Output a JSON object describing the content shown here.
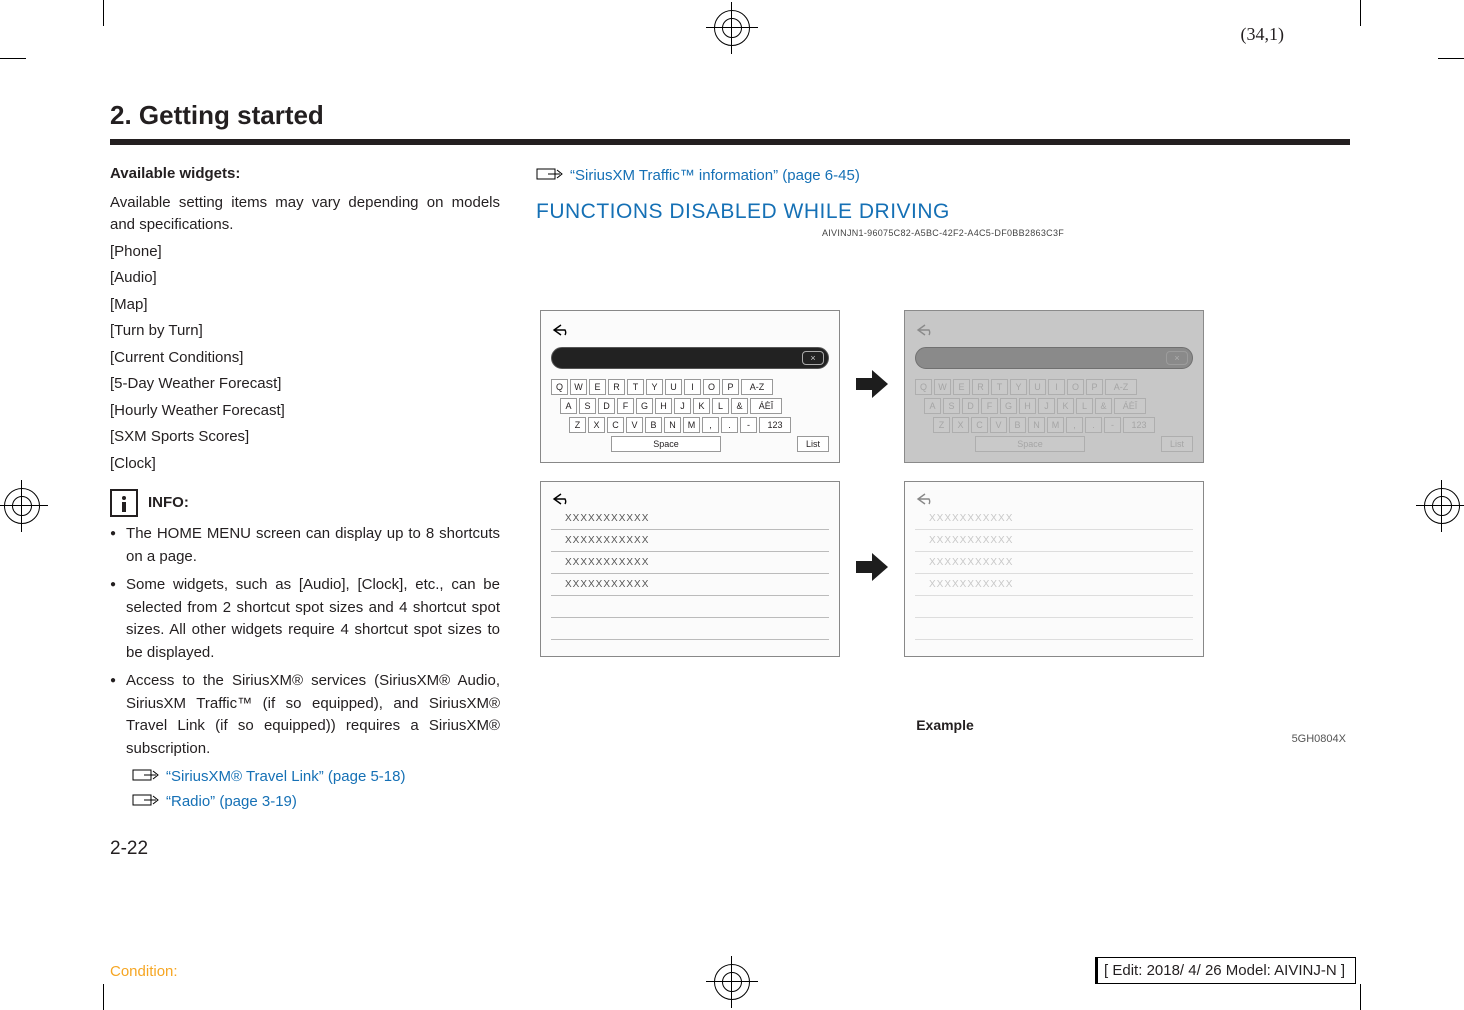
{
  "sheetnum": "(34,1)",
  "title": "2. Getting started",
  "col1": {
    "subhead": "Available widgets:",
    "para": "Available setting items may vary depending on models and specifications.",
    "items": [
      "[Phone]",
      "[Audio]",
      "[Map]",
      "[Turn by Turn]",
      "[Current Conditions]",
      "[5-Day Weather Forecast]",
      "[Hourly Weather Forecast]",
      "[SXM Sports Scores]",
      "[Clock]"
    ],
    "info_label": "INFO:",
    "bullets": [
      "The HOME MENU screen can display up to 8 shortcuts on a page.",
      "Some widgets, such as [Audio], [Clock], etc., can be selected from 2 shortcut spot sizes and 4 shortcut spot sizes. All other widgets require 4 shortcut spot sizes to be displayed.",
      "Access to the SiriusXM® services (SiriusXM® Audio, SiriusXM Traffic™ (if so equipped), and SiriusXM® Travel Link (if so equipped)) requires a SiriusXM® subscription."
    ],
    "xrefs": [
      "“SiriusXM® Travel Link” (page 5-18)",
      "“Radio” (page 3-19)"
    ]
  },
  "pgnum": "2-22",
  "col2": {
    "xref": "“SiriusXM Traffic™ information” (page 6-45)",
    "heading": "FUNCTIONS DISABLED WHILE DRIVING",
    "guid": "AIVINJN1-96075C82-A5BC-42F2-A4C5-DF0BB2863C3F"
  },
  "figure": {
    "kbd": {
      "r1": [
        "Q",
        "W",
        "E",
        "R",
        "T",
        "Y",
        "U",
        "I",
        "O",
        "P",
        "A-Z"
      ],
      "r2": [
        "A",
        "S",
        "D",
        "F",
        "G",
        "H",
        "J",
        "K",
        "L",
        "&",
        "ÁÈÎ"
      ],
      "r3": [
        "Z",
        "X",
        "C",
        "V",
        "B",
        "N",
        "M",
        ",",
        ".",
        "-",
        "123"
      ],
      "space": "Space",
      "list": "List",
      "clear": "×"
    },
    "listtext": "XXXXXXXXXXX",
    "caption": "Example",
    "id": "5GH0804X"
  },
  "cond": "Condition:",
  "edit": "[ Edit: 2018/ 4/ 26   Model:  AIVINJ-N ]"
}
